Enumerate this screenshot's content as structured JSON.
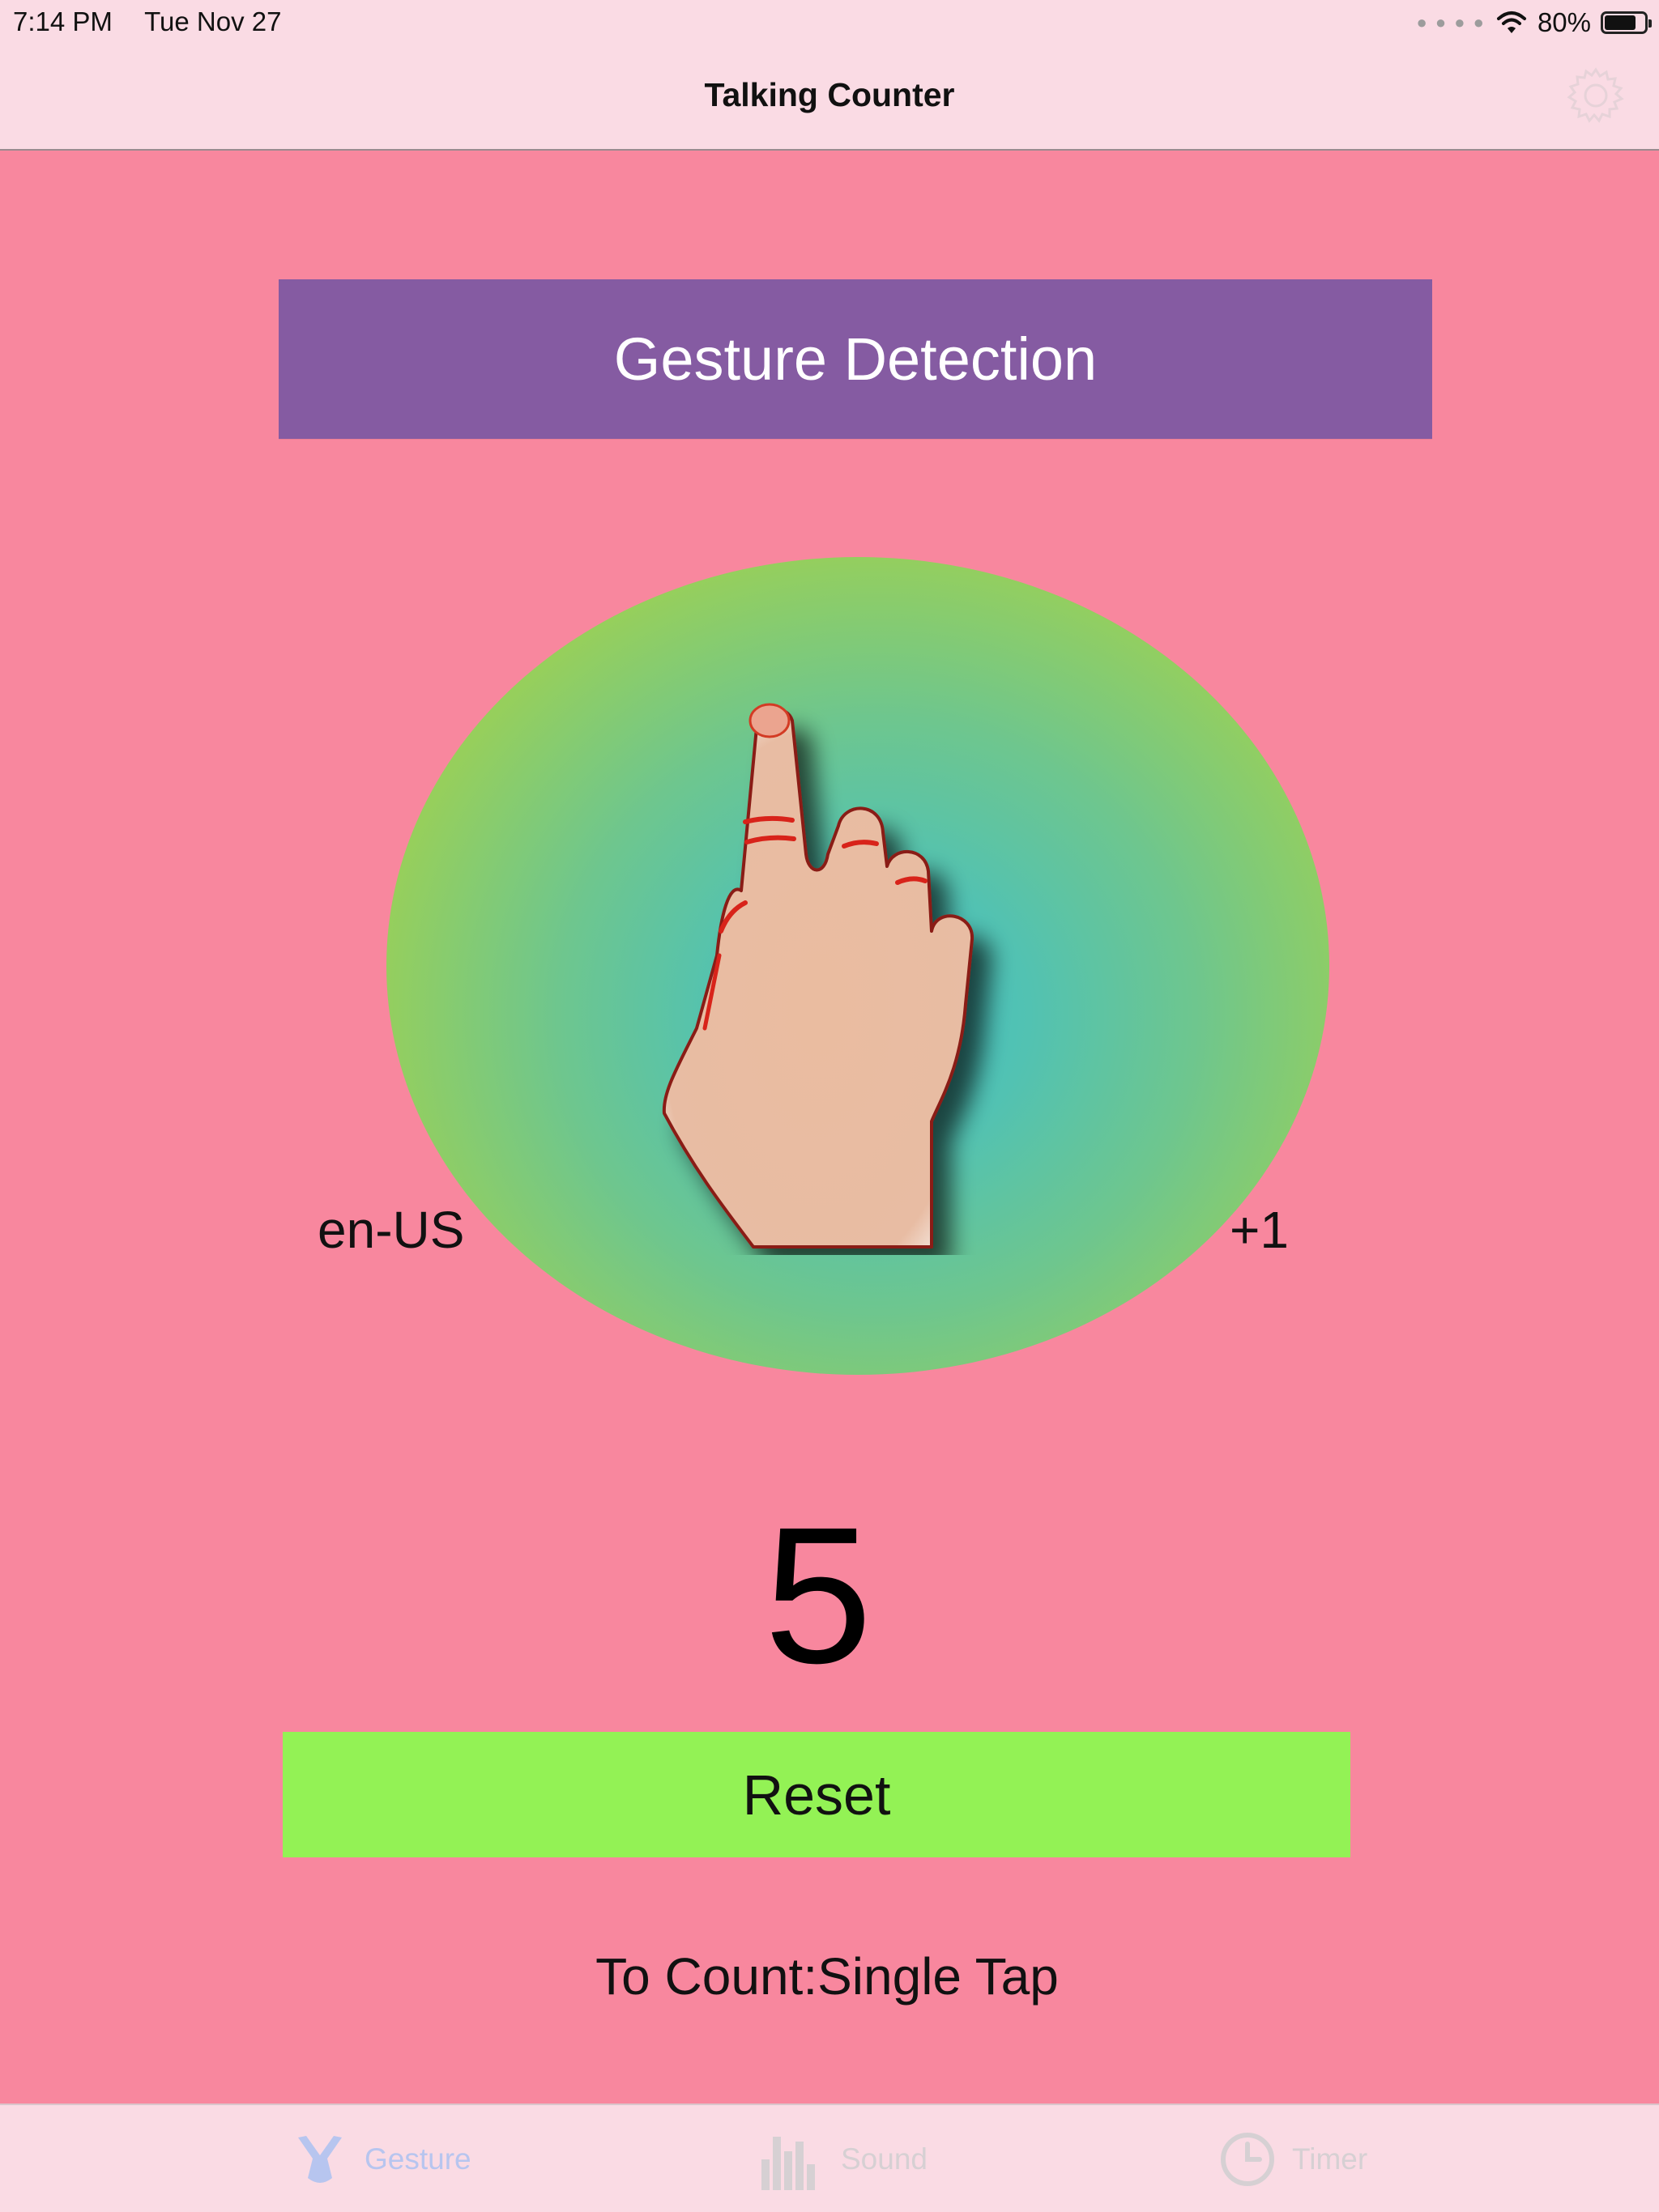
{
  "status_bar": {
    "time": "7:14 PM",
    "date": "Tue Nov 27",
    "battery_percent_text": "80%",
    "battery_level": 0.8,
    "signal_icon": "signal-dots-icon",
    "wifi_icon": "wifi-icon"
  },
  "nav": {
    "title": "Talking Counter",
    "settings_icon": "gear-icon"
  },
  "main": {
    "banner_title": "Gesture Detection",
    "language": "en-US",
    "step": "+1",
    "count": "5",
    "reset_label": "Reset",
    "mode_text": "To Count:Single Tap",
    "hand_icon": "pointing-hand-icon"
  },
  "tabs": [
    {
      "label": "Gesture",
      "icon": "gesture-icon",
      "selected": true
    },
    {
      "label": "Sound",
      "icon": "sound-bars-icon",
      "selected": false
    },
    {
      "label": "Timer",
      "icon": "clock-icon",
      "selected": false
    }
  ],
  "colors": {
    "background": "#f8879e",
    "bar_background": "#fadbe4",
    "banner": "#855ba2",
    "reset_button": "#93f255",
    "tab_selected": "#b7c5ef",
    "tab_unselected": "#d6d0d3"
  }
}
